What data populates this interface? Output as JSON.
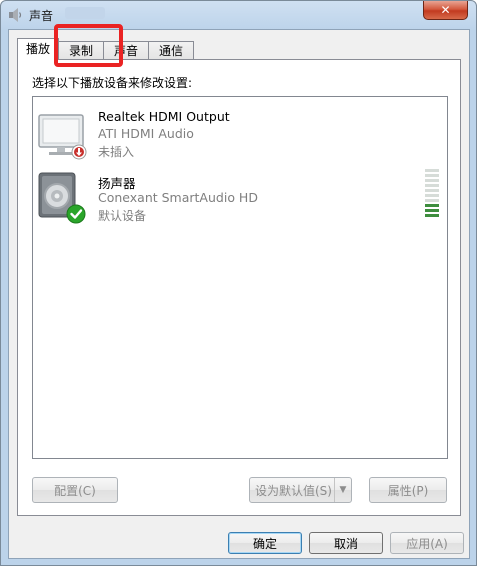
{
  "window": {
    "title": "声音",
    "close_glyph": "✕"
  },
  "tabs": [
    {
      "label": "播放",
      "active": true
    },
    {
      "label": "录制",
      "active": false
    },
    {
      "label": "声音",
      "active": false
    },
    {
      "label": "通信",
      "active": false
    }
  ],
  "panel": {
    "instruction": "选择以下播放设备来修改设置:"
  },
  "devices": [
    {
      "name": "Realtek HDMI Output",
      "description": "ATI HDMI Audio",
      "status": "未插入",
      "icon": "monitor-icon",
      "badge": "unplugged-badge-icon"
    },
    {
      "name": "扬声器",
      "description": "Conexant SmartAudio HD",
      "status": "默认设备",
      "icon": "speaker-icon",
      "badge": "default-checkmark-icon",
      "level_segments_total": 10,
      "level_segments_lit": 3
    }
  ],
  "buttons": {
    "configure": "配置(C)",
    "set_default": "设为默认值(S)",
    "properties": "属性(P)",
    "ok": "确定",
    "cancel": "取消",
    "apply": "应用(A)"
  },
  "colors": {
    "highlight": "#ea2323",
    "level_on": "#3e8e3e",
    "default_badge": "#2aa52a",
    "unplugged_badge": "#c8302c"
  }
}
